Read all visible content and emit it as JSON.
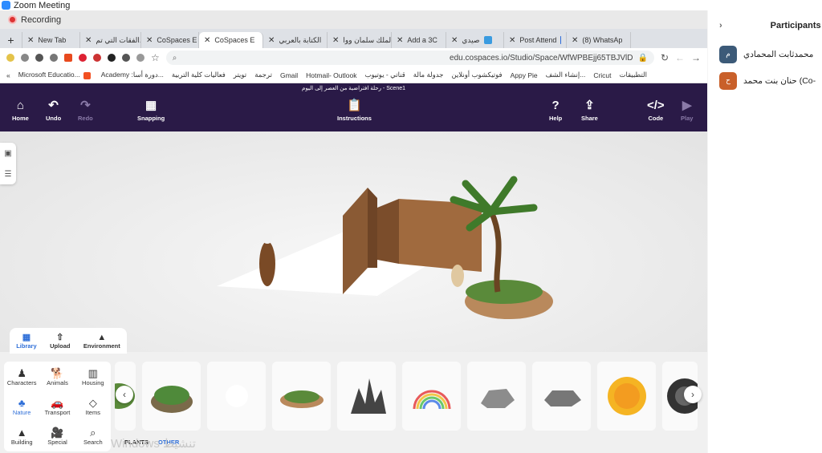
{
  "zoom": {
    "window_title": "Zoom Meeting"
  },
  "recording": {
    "label": "Recording"
  },
  "browser": {
    "tabs": [
      {
        "label": "",
        "icon": "plus-icon"
      },
      {
        "label": "New Tab"
      },
      {
        "label": "الفقات التي تم..."
      },
      {
        "label": "CoSpaces E"
      },
      {
        "label": "CoSpaces E"
      },
      {
        "label": "الكتابة بالعربي"
      },
      {
        "label": "الملك سلمان ووا..."
      },
      {
        "label": "Add a 3C"
      },
      {
        "label": "صيدي"
      },
      {
        "label": "Post Attend"
      },
      {
        "label": "(8) WhatsAp"
      }
    ],
    "url": "edu.cospaces.io/Studio/Space/WfWPBEjj65TBJVlD",
    "bookmarks": [
      "Microsoft Educatio...",
      "Academy :دورة أسا...",
      "فعاليات كلية التربية",
      "تويتر",
      "ترجمة",
      "Gmail",
      "Hotmail- Outlook",
      "قناتي - يوتيوب",
      "جدولة مالة",
      "فوتيكشوب أونلاين",
      "Appy Pie",
      "إنشاء الشف...",
      "Cricut",
      "التطبيقات"
    ]
  },
  "cospaces": {
    "scene_title": "رحلة افتراضية من العصر إلى اليوم - Scene1",
    "toolbar": {
      "home": "Home",
      "undo": "Undo",
      "redo": "Redo",
      "snapping": "Snapping",
      "instructions": "Instructions",
      "help": "Help",
      "share": "Share",
      "code": "Code",
      "play": "Play"
    },
    "library_tabs": [
      "Library",
      "Upload",
      "Environment"
    ],
    "categories": [
      "Characters",
      "Animals",
      "Housing",
      "Nature",
      "Transport",
      "Items",
      "Building",
      "Special",
      "Search"
    ],
    "active_category": "Nature",
    "subtabs": {
      "plants": "PLANTS",
      "other": "OTHER"
    }
  },
  "watermark": "Windows تنشيط",
  "participants": {
    "header": "Participants",
    "list": [
      {
        "initial": "م",
        "name": "محمدثابت المحمادي",
        "color": "#3c5a78"
      },
      {
        "initial": "ح",
        "name": "حنان بنت محمد (Co-",
        "color": "#c9602a"
      }
    ]
  }
}
